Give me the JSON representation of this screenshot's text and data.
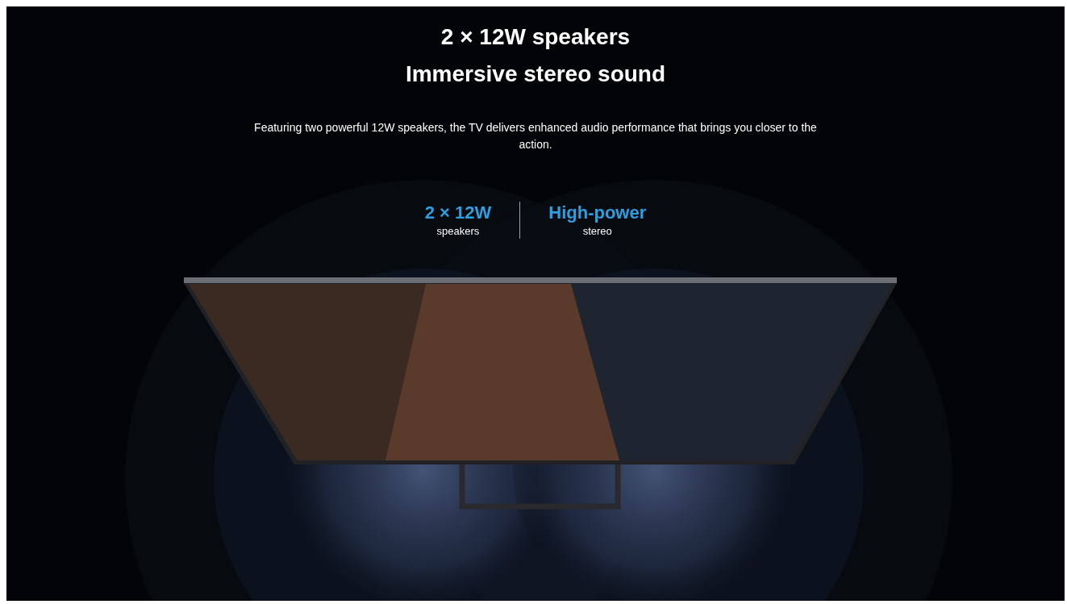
{
  "headline": [
    "2 × 12W speakers",
    "Immersive stereo sound"
  ],
  "description": "Featuring two powerful 12W speakers, the TV delivers enhanced audio performance that brings you closer to the action.",
  "stats": [
    {
      "value": "2 × 12W",
      "label": "speakers"
    },
    {
      "value": "High-power",
      "label": "stereo"
    }
  ]
}
